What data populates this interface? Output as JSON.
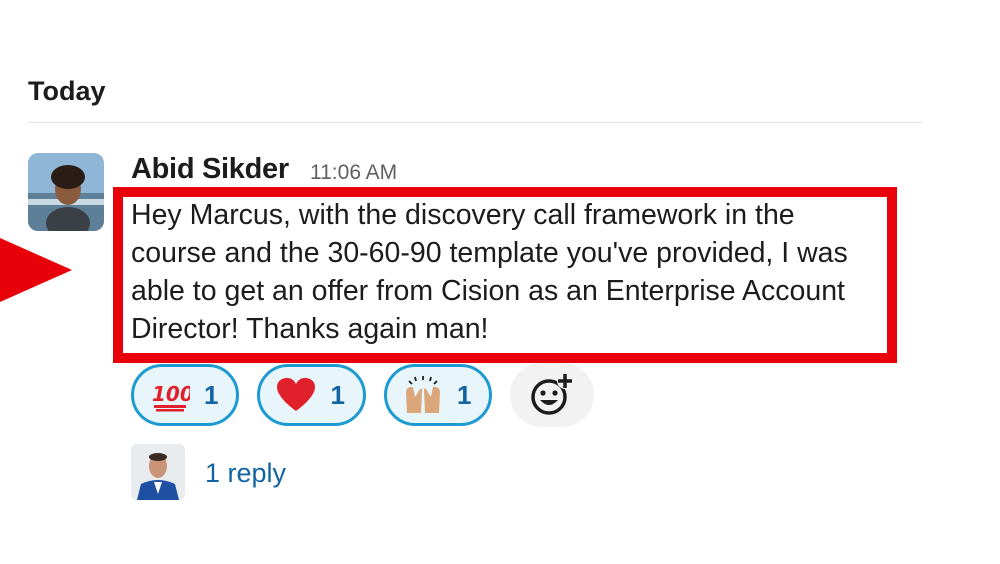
{
  "day_header": "Today",
  "message": {
    "sender": "Abid Sikder",
    "time": "11:06 AM",
    "text": "Hey Marcus, with the discovery call framework in the course and the 30-60-90 template you've provided, I was able to get an offer from Cision as an Enterprise Account Director! Thanks again man!",
    "avatar_icon": "user-photo-avatar"
  },
  "reactions": [
    {
      "emoji": "hundred-points-icon",
      "count": "1"
    },
    {
      "emoji": "red-heart-icon",
      "count": "1"
    },
    {
      "emoji": "raising-hands-icon",
      "count": "1"
    }
  ],
  "add_reaction_icon": "add-reaction-icon",
  "thread": {
    "replies": "1 reply",
    "avatar_icon": "replier-photo-avatar"
  },
  "colors": {
    "highlight": "#e8000b",
    "reaction_border": "#1d9bd1",
    "reaction_bg": "#e8f5fa",
    "link": "#1264a3"
  }
}
